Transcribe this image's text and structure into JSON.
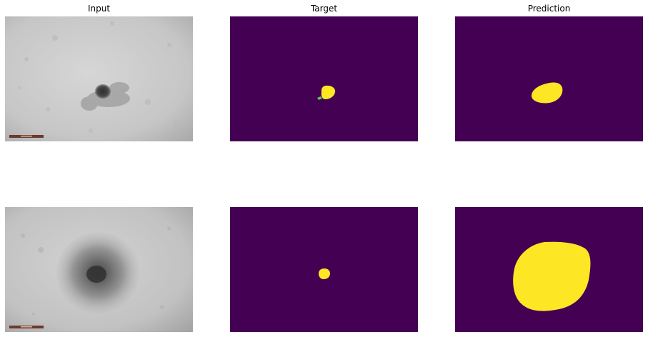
{
  "columns": {
    "input": "Input",
    "target": "Target",
    "prediction": "Prediction"
  },
  "colors": {
    "mask_background": "#440154",
    "mask_foreground": "#fde725",
    "mask_edge": "#5ec962",
    "microscope_light": "#d2d2d2",
    "microscope_dark": "#a9a9a9",
    "scale_bar": "#6b3a2a"
  },
  "rows": [
    {
      "row": 1,
      "panels": [
        "input",
        "target",
        "prediction"
      ]
    },
    {
      "row": 2,
      "panels": [
        "input",
        "target",
        "prediction"
      ]
    }
  ]
}
